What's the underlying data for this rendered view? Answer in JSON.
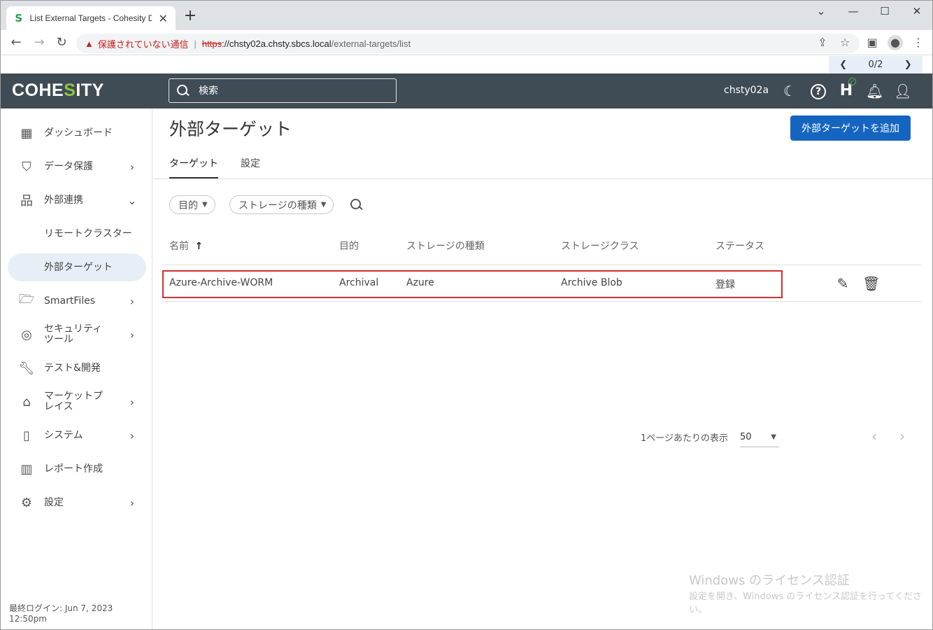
{
  "browser": {
    "tab_title": "List External Targets - Cohesity D",
    "new_tab": "+",
    "warning": "保護されていない通信",
    "url_scheme": "https",
    "url_host": "://chsty02a.chsty.sbcs.local",
    "url_path": "/external-targets/list",
    "find_count": "0/2"
  },
  "app": {
    "logo_pre": "COHE",
    "logo_s": "S",
    "logo_post": "ITY",
    "search_placeholder": "検索",
    "cluster_name": "chsty02a"
  },
  "sidebar": {
    "items": [
      {
        "label": "ダッシュボード"
      },
      {
        "label": "データ保護"
      },
      {
        "label": "外部連携"
      },
      {
        "label": "リモートクラスター"
      },
      {
        "label": "外部ターゲット"
      },
      {
        "label": "SmartFiles"
      },
      {
        "label": "セキュリティツール"
      },
      {
        "label": "テスト&開発"
      },
      {
        "label": "マーケットプレイス"
      },
      {
        "label": "システム"
      },
      {
        "label": "レポート作成"
      },
      {
        "label": "設定"
      }
    ],
    "last_login": "最終ログイン: Jun 7, 2023 12:50pm"
  },
  "main": {
    "title": "外部ターゲット",
    "add_button": "外部ターゲットを追加",
    "tabs": [
      {
        "label": "ターゲット"
      },
      {
        "label": "設定"
      }
    ],
    "filters": [
      {
        "label": "目的"
      },
      {
        "label": "ストレージの種類"
      }
    ],
    "table": {
      "columns": [
        "名前",
        "目的",
        "ストレージの種類",
        "ストレージクラス",
        "ステータス"
      ],
      "sort_arrow": "↑",
      "rows": [
        {
          "name": "Azure-Archive-WORM",
          "purpose": "Archival",
          "storage_type": "Azure",
          "storage_class": "Archive Blob",
          "status": "登録"
        }
      ]
    },
    "pager": {
      "label": "1ページあたりの表示",
      "value": "50"
    }
  },
  "watermark": {
    "line1": "Windows のライセンス認証",
    "line2": "設定を開き、Windows のライセンス認証を行ってください。"
  }
}
